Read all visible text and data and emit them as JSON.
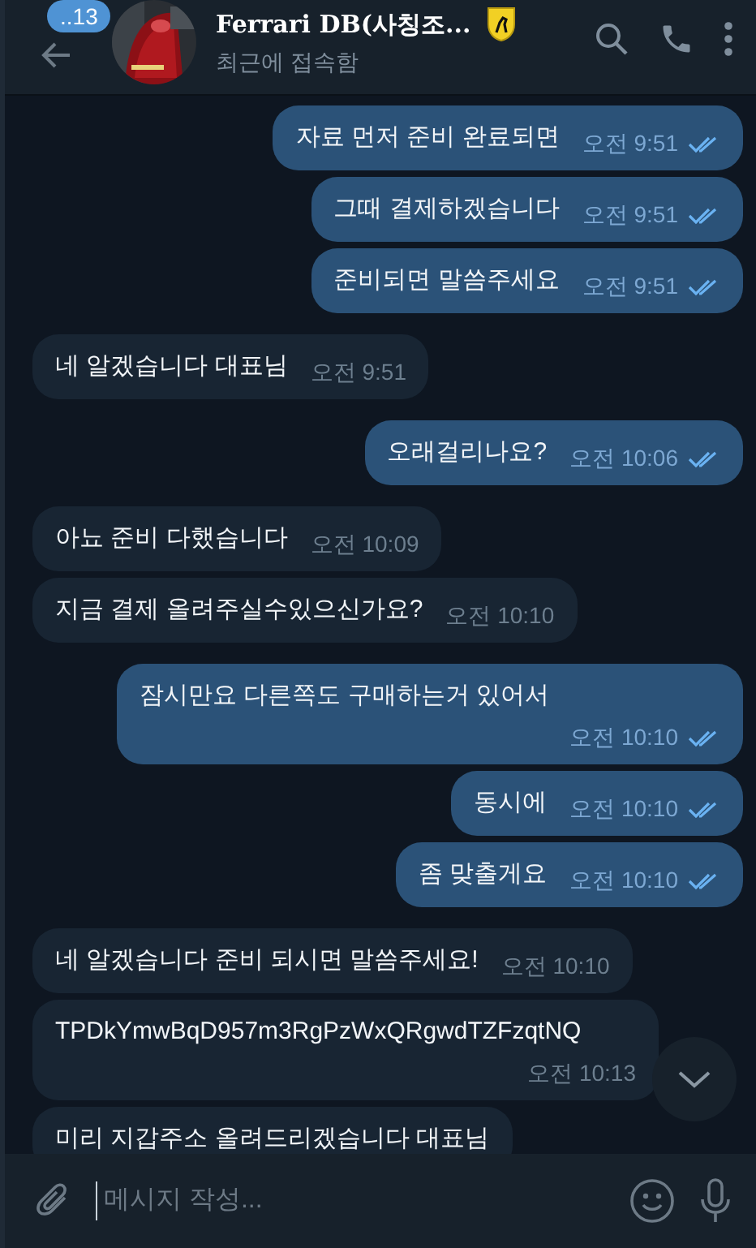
{
  "header": {
    "back_badge": "..13",
    "title": "Ferrari DB(사칭조...",
    "status": "최근에 접속함"
  },
  "messages": [
    {
      "kind": "out",
      "text": "자료 먼저 준비 완료되면",
      "time": "오전 9:51",
      "read": true
    },
    {
      "kind": "out",
      "text": "그때 결제하겠습니다",
      "time": "오전 9:51",
      "read": true
    },
    {
      "kind": "out",
      "text": "준비되면 말씀주세요",
      "time": "오전 9:51",
      "read": true
    },
    {
      "kind": "in",
      "text": "네 알겠습니다 대표님",
      "time": "오전 9:51"
    },
    {
      "kind": "out",
      "text": "오래걸리나요?",
      "time": "오전 10:06",
      "read": true
    },
    {
      "kind": "in",
      "text": "아뇨 준비 다했습니다",
      "time": "오전 10:09"
    },
    {
      "kind": "in",
      "text": "지금 결제 올려주실수있으신가요?",
      "time": "오전 10:10"
    },
    {
      "kind": "out",
      "text": "잠시만요 다른쪽도 구매하는거 있어서",
      "time": "오전 10:10",
      "read": true
    },
    {
      "kind": "out",
      "text": "동시에",
      "time": "오전 10:10",
      "read": true
    },
    {
      "kind": "out",
      "text": "좀 맞출게요",
      "time": "오전 10:10",
      "read": true
    },
    {
      "kind": "in",
      "text": "네 알겠습니다 준비 되시면 말씀주세요!",
      "time": "오전 10:10"
    },
    {
      "kind": "in",
      "text": "TPDkYmwBqD957m3RgPzWxQRgwdTZFzqtNQ",
      "time": "오전 10:13"
    },
    {
      "kind": "in",
      "text": "미리 지갑주소 올려드리겠습니다 대표님"
    }
  ],
  "composer": {
    "placeholder": "메시지 작성..."
  }
}
